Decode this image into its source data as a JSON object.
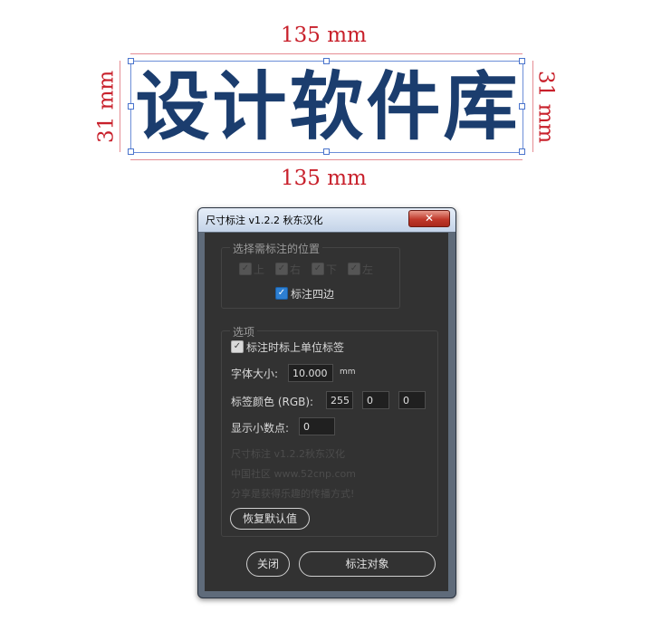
{
  "artwork": {
    "title": "设计软件库",
    "width_label_top": "135 mm",
    "width_label_bottom": "135 mm",
    "height_label_left": "31 mm",
    "height_label_right": "31 mm",
    "title_color": "#1b3d6e",
    "dimension_color": "#c8202b"
  },
  "dialog": {
    "title": "尺寸标注 v1.2.2 秋东汉化",
    "close_label": "✕",
    "position_group": {
      "label": "选择需标注的位置",
      "sides": [
        {
          "label": "上",
          "checked": true,
          "enabled": false
        },
        {
          "label": "右",
          "checked": true,
          "enabled": false
        },
        {
          "label": "下",
          "checked": true,
          "enabled": false
        },
        {
          "label": "左",
          "checked": true,
          "enabled": false
        }
      ],
      "four_sides_label": "标注四边",
      "four_sides_checked": true
    },
    "options_group": {
      "label": "选项",
      "unit_label_checkbox": "标注时标上单位标签",
      "unit_label_checked": true,
      "font_size_label": "字体大小:",
      "font_size_value": "10.000",
      "font_size_unit": "mm",
      "color_label": "标签颜色 (RGB):",
      "color_r": "255",
      "color_g": "0",
      "color_b": "0",
      "decimals_label": "显示小数点:",
      "decimals_value": "0",
      "info_line_1": "尺寸标注 v1.2.2秋东汉化",
      "info_line_2": "中国社区 www.52cnp.com",
      "info_line_3": "分享是获得乐趣的传播方式!",
      "reset_button": "恢复默认值"
    },
    "close_button": "关闭",
    "apply_button": "标注对象"
  }
}
